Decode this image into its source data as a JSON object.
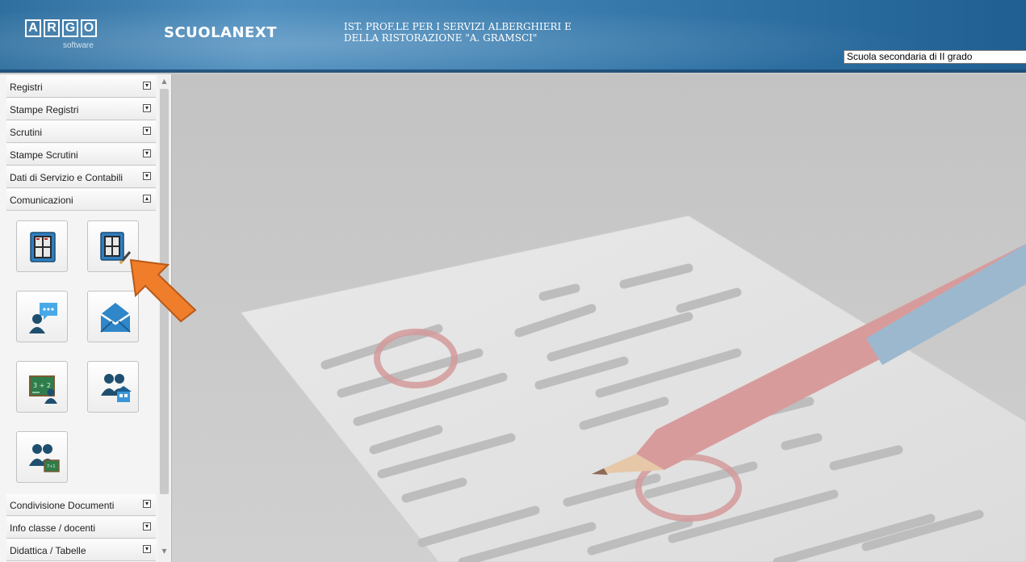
{
  "header": {
    "logo_letters": [
      "A",
      "R",
      "G",
      "O"
    ],
    "logo_subtitle": "software",
    "product": "SCUOLANEXT",
    "school_name": "IST. PROF.LE PER I SERVIZI ALBERGHIERI E\nDELLA RISTORAZIONE \"A. GRAMSCI\"",
    "school_type": "Scuola secondaria di II grado"
  },
  "sidebar": {
    "sections": [
      {
        "label": "Registri",
        "state": "collapsed"
      },
      {
        "label": "Stampe Registri",
        "state": "collapsed"
      },
      {
        "label": "Scrutini",
        "state": "collapsed"
      },
      {
        "label": "Stampe Scrutini",
        "state": "collapsed"
      },
      {
        "label": "Dati di Servizio e Contabili",
        "state": "collapsed"
      },
      {
        "label": "Comunicazioni",
        "state": "expanded"
      },
      {
        "label": "Condivisione Documenti",
        "state": "collapsed"
      },
      {
        "label": "Info classe / docenti",
        "state": "collapsed"
      },
      {
        "label": "Didattica / Tabelle",
        "state": "collapsed"
      }
    ],
    "comunicazioni_tiles": [
      {
        "icon": "bulletin-board-icon"
      },
      {
        "icon": "bulletin-board-edit-icon"
      },
      {
        "icon": "user-message-icon"
      },
      {
        "icon": "envelope-icon"
      },
      {
        "icon": "blackboard-teacher-icon"
      },
      {
        "icon": "parents-school-icon"
      },
      {
        "icon": "parents-blackboard-icon"
      }
    ]
  },
  "colors": {
    "header_blue": "#3a7cae",
    "arrow_orange": "#f07d2a"
  }
}
